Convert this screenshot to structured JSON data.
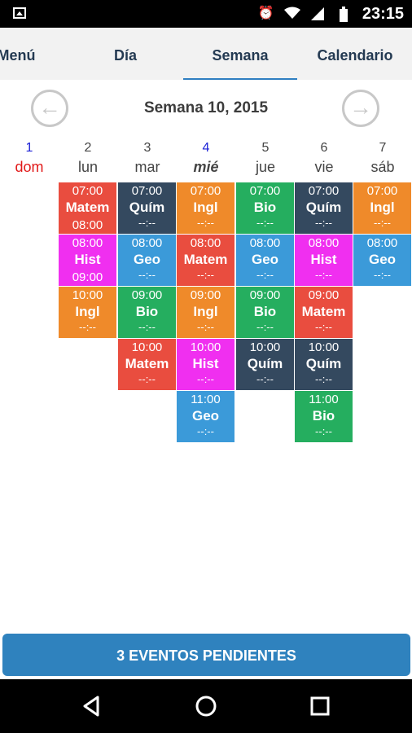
{
  "status_bar": {
    "time": "23:15",
    "icons": [
      "image-icon",
      "alarm-icon",
      "wifi-icon",
      "signal-icon",
      "battery-icon"
    ]
  },
  "tabs": [
    {
      "label": "Menú",
      "active": false
    },
    {
      "label": "Día",
      "active": false
    },
    {
      "label": "Semana",
      "active": true
    },
    {
      "label": "Calendario",
      "active": false
    }
  ],
  "week": {
    "title": "Semana 10, 2015"
  },
  "days": [
    {
      "num": "1",
      "name": "dom"
    },
    {
      "num": "2",
      "name": "lun"
    },
    {
      "num": "3",
      "name": "mar"
    },
    {
      "num": "4",
      "name": "mié"
    },
    {
      "num": "5",
      "name": "jue"
    },
    {
      "num": "6",
      "name": "vie"
    },
    {
      "num": "7",
      "name": "sáb"
    }
  ],
  "events": {
    "lun": [
      {
        "start": "07:00",
        "name": "Matem",
        "end": "08:00",
        "color": "#e94d3f"
      },
      {
        "start": "08:00",
        "name": "Hist",
        "end": "09:00",
        "color": "#f02ff0"
      },
      {
        "start": "10:00",
        "name": "Ingl",
        "end": "--:--",
        "color": "#ef8a2a"
      }
    ],
    "mar": [
      {
        "start": "07:00",
        "name": "Quím",
        "end": "--:--",
        "color": "#34495f"
      },
      {
        "start": "08:00",
        "name": "Geo",
        "end": "--:--",
        "color": "#3b9ad9"
      },
      {
        "start": "09:00",
        "name": "Bio",
        "end": "--:--",
        "color": "#25ae5f"
      },
      {
        "start": "10:00",
        "name": "Matem",
        "end": "--:--",
        "color": "#e94d3f"
      }
    ],
    "mie": [
      {
        "start": "07:00",
        "name": "Ingl",
        "end": "--:--",
        "color": "#ef8a2a"
      },
      {
        "start": "08:00",
        "name": "Matem",
        "end": "--:--",
        "color": "#e94d3f"
      },
      {
        "start": "09:00",
        "name": "Ingl",
        "end": "--:--",
        "color": "#ef8a2a"
      },
      {
        "start": "10:00",
        "name": "Hist",
        "end": "--:--",
        "color": "#f02ff0"
      },
      {
        "start": "11:00",
        "name": "Geo",
        "end": "--:--",
        "color": "#3b9ad9"
      }
    ],
    "jue": [
      {
        "start": "07:00",
        "name": "Bio",
        "end": "--:--",
        "color": "#25ae5f"
      },
      {
        "start": "08:00",
        "name": "Geo",
        "end": "--:--",
        "color": "#3b9ad9"
      },
      {
        "start": "09:00",
        "name": "Bio",
        "end": "--:--",
        "color": "#25ae5f"
      },
      {
        "start": "10:00",
        "name": "Quím",
        "end": "--:--",
        "color": "#34495f"
      }
    ],
    "vie": [
      {
        "start": "07:00",
        "name": "Quím",
        "end": "--:--",
        "color": "#34495f"
      },
      {
        "start": "08:00",
        "name": "Hist",
        "end": "--:--",
        "color": "#f02ff0"
      },
      {
        "start": "09:00",
        "name": "Matem",
        "end": "--:--",
        "color": "#e94d3f"
      },
      {
        "start": "10:00",
        "name": "Quím",
        "end": "--:--",
        "color": "#34495f"
      },
      {
        "start": "11:00",
        "name": "Bio",
        "end": "--:--",
        "color": "#25ae5f"
      }
    ],
    "sab": [
      {
        "start": "07:00",
        "name": "Ingl",
        "end": "--:--",
        "color": "#ef8a2a"
      },
      {
        "start": "08:00",
        "name": "Geo",
        "end": "--:--",
        "color": "#3b9ad9"
      }
    ]
  },
  "pending_button": {
    "label": "3 EVENTOS PENDIENTES"
  },
  "nav_bar": {
    "icons": [
      "back-icon",
      "home-icon",
      "recents-icon"
    ]
  },
  "colors": {
    "accent": "#2f82be",
    "tab_text": "#243a52",
    "sunday_num": "#1d22d6",
    "sunday_name": "#e11919"
  }
}
